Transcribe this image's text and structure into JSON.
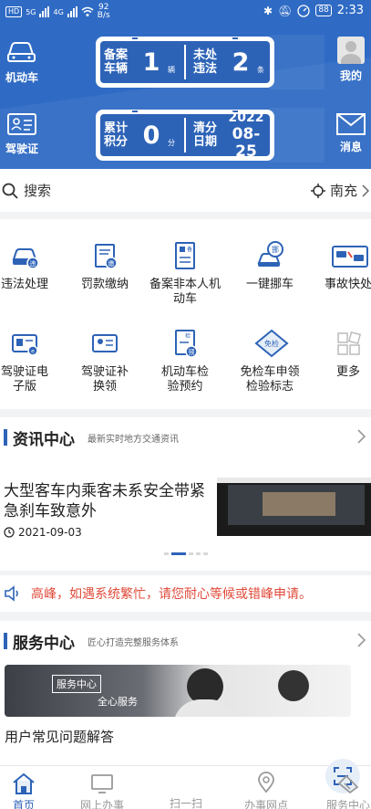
{
  "status_bar": {
    "left_badges": [
      "HD",
      "5G",
      "4G"
    ],
    "speed_value": "92",
    "speed_unit": "B/s",
    "battery": "88",
    "time": "2:33"
  },
  "header": {
    "left_top_label": "机动车",
    "left_bottom_label": "驾驶证",
    "right_top_label": "我的",
    "right_bottom_label": "消息",
    "plate1": {
      "label1": "备案车辆",
      "value1": "1",
      "unit1": "辆",
      "label2": "未处违法",
      "value2": "2",
      "unit2": "条"
    },
    "plate2": {
      "label1": "累计积分",
      "value1": "0",
      "unit1": "分",
      "label2": "清分日期",
      "date_year": "2022",
      "date_md": "08-25"
    }
  },
  "search": {
    "placeholder": "搜索",
    "location": "南充"
  },
  "services": [
    {
      "label": "违法处理",
      "icon": "violation-car-icon"
    },
    {
      "label": "罚款缴纳",
      "icon": "fine-payment-icon"
    },
    {
      "label": "备案非本人机动车",
      "icon": "register-vehicle-icon"
    },
    {
      "label": "一键挪车",
      "icon": "move-car-icon"
    },
    {
      "label": "事故快处",
      "icon": "accident-icon"
    },
    {
      "label": "驾驶证电子版",
      "icon": "e-license-icon"
    },
    {
      "label": "驾驶证补换领",
      "icon": "license-renew-icon"
    },
    {
      "label": "机动车检验预约",
      "icon": "inspection-booking-icon"
    },
    {
      "label": "免检车申领检验标志",
      "icon": "exempt-inspection-icon"
    },
    {
      "label": "更多",
      "icon": "more-grid-icon"
    }
  ],
  "news": {
    "title": "资讯中心",
    "subtitle": "最新实时地方交通资讯",
    "headline": "大型客车内乘客未系安全带紧急刹车致意外",
    "date": "2021-09-03"
  },
  "notice": {
    "text": "高峰，如遇系统繁忙，请您耐心等候或错峰申请。"
  },
  "service_center": {
    "title": "服务中心",
    "subtitle": "匠心打造完整服务体系",
    "banner_tag": "服务中心",
    "banner_text": "全心服务",
    "faq_title": "用户常见问题解答"
  },
  "tabbar": {
    "tabs": [
      "首页",
      "网上办事",
      "扫一扫",
      "办事网点",
      "服务中心"
    ]
  },
  "colors": {
    "brand_blue": "#2d63b7",
    "header_blue": "#2f6bc4",
    "notice_red": "#e04a3a"
  }
}
